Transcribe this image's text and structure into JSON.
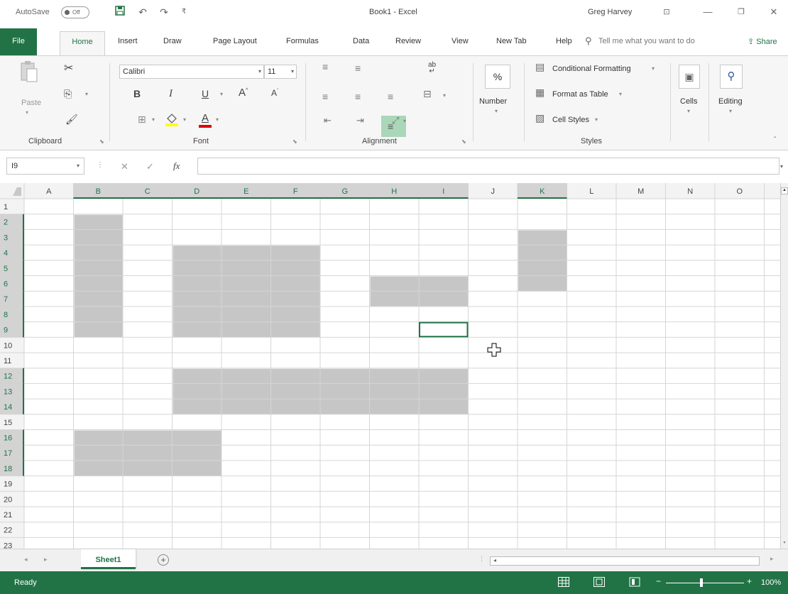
{
  "titlebar": {
    "autosave_label": "AutoSave",
    "autosave_state": "Off",
    "doc_title": "Book1  -  Excel",
    "user_name": "Greg Harvey",
    "quick_access_icons": [
      "save-icon",
      "undo-icon",
      "redo-icon",
      "customize-qat-icon"
    ]
  },
  "tabs": [
    "File",
    "Home",
    "Insert",
    "Draw",
    "Page Layout",
    "Formulas",
    "Data",
    "Review",
    "View",
    "New Tab",
    "Help"
  ],
  "active_tab": "Home",
  "tell_me": "Tell me what you want to do",
  "share_label": "Share",
  "ribbon": {
    "clipboard": {
      "paste_label": "Paste",
      "group_label": "Clipboard"
    },
    "font": {
      "font_name": "Calibri",
      "font_size": "11",
      "bold": "B",
      "italic": "I",
      "underline": "U",
      "grow": "A",
      "shrink": "A",
      "font_color_letter": "A",
      "group_label": "Font",
      "fill_color": "#ffff00",
      "font_color": "#e00000"
    },
    "alignment": {
      "group_label": "Alignment",
      "wrap_icon_text": "ab",
      "active_button": "Middle Align"
    },
    "number": {
      "label": "Number",
      "symbol": "%"
    },
    "styles": {
      "conditional": "Conditional Formatting",
      "format_table": "Format as Table",
      "cell_styles": "Cell Styles",
      "group_label": "Styles"
    },
    "cells": {
      "label": "Cells"
    },
    "editing": {
      "label": "Editing"
    }
  },
  "formula_bar": {
    "name_box": "I9",
    "fx": "fx",
    "value": ""
  },
  "grid": {
    "columns": [
      "A",
      "B",
      "C",
      "D",
      "E",
      "F",
      "G",
      "H",
      "I",
      "J",
      "K",
      "L",
      "M",
      "N",
      "O"
    ],
    "rows": [
      "1",
      "2",
      "3",
      "4",
      "5",
      "6",
      "7",
      "8",
      "9",
      "10",
      "11",
      "12",
      "13",
      "14",
      "15",
      "16",
      "17",
      "18",
      "19",
      "20",
      "21",
      "22",
      "23"
    ],
    "selected_ranges": [
      "B2:B9",
      "D4:F9",
      "H6:I7",
      "K3:K6",
      "D12:I14",
      "B16:D18"
    ],
    "active_cell": "I9",
    "highlight_color": "#c6c6c6",
    "accent_color": "#217346"
  },
  "sheets": [
    "Sheet1"
  ],
  "active_sheet": "Sheet1",
  "status": {
    "ready": "Ready",
    "zoom": "100%"
  }
}
